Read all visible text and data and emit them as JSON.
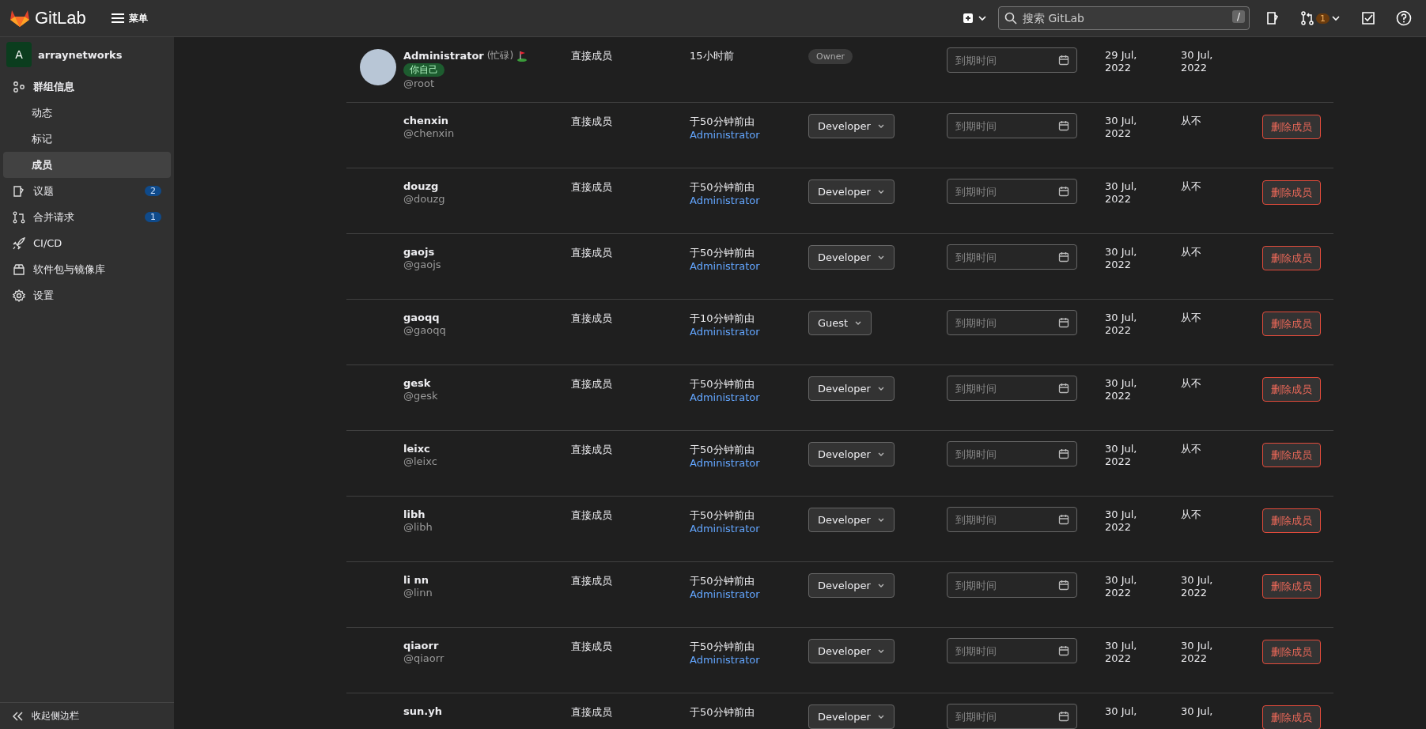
{
  "topbar": {
    "brand": "GitLab",
    "menu_label": "菜单",
    "search": {
      "placeholder": "搜索 GitLab",
      "shortcut": "/"
    },
    "mr_count": "1"
  },
  "sidebar": {
    "group": {
      "initial": "A",
      "name": "arraynetworks"
    },
    "items": [
      {
        "kind": "section",
        "label": "群组信息",
        "expanded": true,
        "children": [
          {
            "label": "动态",
            "selected": false
          },
          {
            "label": "标记",
            "selected": false
          },
          {
            "label": "成员",
            "selected": true
          }
        ]
      },
      {
        "kind": "link",
        "label": "议题",
        "count": "2"
      },
      {
        "kind": "link",
        "label": "合并请求",
        "count": "1"
      },
      {
        "kind": "link",
        "label": "CI/CD"
      },
      {
        "kind": "link",
        "label": "软件包与镜像库"
      },
      {
        "kind": "link",
        "label": "设置"
      }
    ],
    "collapse_label": "收起侧边栏"
  },
  "members": [
    {
      "name": "Administrator",
      "status": "(忙碌)",
      "self_badge": "你自己",
      "username": "@root",
      "avatar": true,
      "source": "直接成员",
      "granted": "15小时前",
      "kind": "badge",
      "role": "Owner",
      "expiration_placeholder": "到期时间",
      "created": "29 Jul, 2022",
      "last_activity": "30 Jul, 2022"
    },
    {
      "name": "chenxin",
      "username": "@chenxin",
      "source": "直接成员",
      "granted": "于50分钟前由",
      "granted_by": "Administrator",
      "kind": "dropdown",
      "role": "Developer",
      "expiration_placeholder": "到期时间",
      "created": "30 Jul, 2022",
      "last_activity": "从不",
      "remove": "删除成员"
    },
    {
      "name": "douzg",
      "username": "@douzg",
      "source": "直接成员",
      "granted": "于50分钟前由",
      "granted_by": "Administrator",
      "kind": "dropdown",
      "role": "Developer",
      "expiration_placeholder": "到期时间",
      "created": "30 Jul, 2022",
      "last_activity": "从不",
      "remove": "删除成员"
    },
    {
      "name": "gaojs",
      "username": "@gaojs",
      "source": "直接成员",
      "granted": "于50分钟前由",
      "granted_by": "Administrator",
      "kind": "dropdown",
      "role": "Developer",
      "expiration_placeholder": "到期时间",
      "created": "30 Jul, 2022",
      "last_activity": "从不",
      "remove": "删除成员"
    },
    {
      "name": "gaoqq",
      "username": "@gaoqq",
      "source": "直接成员",
      "granted": "于10分钟前由",
      "granted_by": "Administrator",
      "kind": "dropdown",
      "role": "Guest",
      "expiration_placeholder": "到期时间",
      "created": "30 Jul, 2022",
      "last_activity": "从不",
      "remove": "删除成员"
    },
    {
      "name": "gesk",
      "username": "@gesk",
      "source": "直接成员",
      "granted": "于50分钟前由",
      "granted_by": "Administrator",
      "kind": "dropdown",
      "role": "Developer",
      "expiration_placeholder": "到期时间",
      "created": "30 Jul, 2022",
      "last_activity": "从不",
      "remove": "删除成员"
    },
    {
      "name": "leixc",
      "username": "@leixc",
      "source": "直接成员",
      "granted": "于50分钟前由",
      "granted_by": "Administrator",
      "kind": "dropdown",
      "role": "Developer",
      "expiration_placeholder": "到期时间",
      "created": "30 Jul, 2022",
      "last_activity": "从不",
      "remove": "删除成员"
    },
    {
      "name": "libh",
      "username": "@libh",
      "source": "直接成员",
      "granted": "于50分钟前由",
      "granted_by": "Administrator",
      "kind": "dropdown",
      "role": "Developer",
      "expiration_placeholder": "到期时间",
      "created": "30 Jul, 2022",
      "last_activity": "从不",
      "remove": "删除成员"
    },
    {
      "name": "li nn",
      "username": "@linn",
      "source": "直接成员",
      "granted": "于50分钟前由",
      "granted_by": "Administrator",
      "kind": "dropdown",
      "role": "Developer",
      "expiration_placeholder": "到期时间",
      "created": "30 Jul, 2022",
      "last_activity": "30 Jul, 2022",
      "remove": "删除成员"
    },
    {
      "name": "qiaorr",
      "username": "@qiaorr",
      "source": "直接成员",
      "granted": "于50分钟前由",
      "granted_by": "Administrator",
      "kind": "dropdown",
      "role": "Developer",
      "expiration_placeholder": "到期时间",
      "created": "30 Jul, 2022",
      "last_activity": "30 Jul, 2022",
      "remove": "删除成员"
    },
    {
      "name": "sun.yh",
      "source": "直接成员",
      "granted": "于50分钟前由",
      "kind": "dropdown",
      "role": "Developer",
      "expiration_placeholder": "到期时间",
      "created": "30 Jul,",
      "last_activity": "30 Jul,",
      "remove": "删除成员"
    }
  ]
}
